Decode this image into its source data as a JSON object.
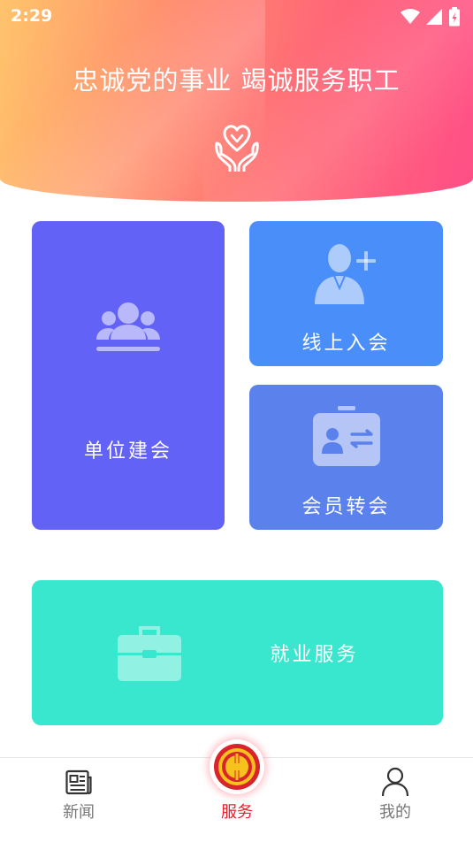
{
  "status_bar": {
    "time": "2:29"
  },
  "header": {
    "slogan": "忠诚党的事业 竭诚服务职工",
    "icon": "hands-heart-icon"
  },
  "tiles": {
    "unit": {
      "label": "单位建会",
      "icon": "group-icon",
      "color": "#6262f6"
    },
    "join": {
      "label": "线上入会",
      "icon": "add-user-icon",
      "color": "#4a8ff9"
    },
    "transfer": {
      "label": "会员转会",
      "icon": "id-card-transfer-icon",
      "color": "#5b82ec"
    },
    "job": {
      "label": "就业服务",
      "icon": "briefcase-icon",
      "color": "#38e7cd"
    }
  },
  "nav": {
    "items": [
      {
        "label": "新闻",
        "icon": "newspaper-icon"
      },
      {
        "label": "服务",
        "icon": "union-emblem-icon",
        "active": true
      },
      {
        "label": "我的",
        "icon": "user-icon"
      }
    ],
    "active_color": "#e8222a"
  }
}
